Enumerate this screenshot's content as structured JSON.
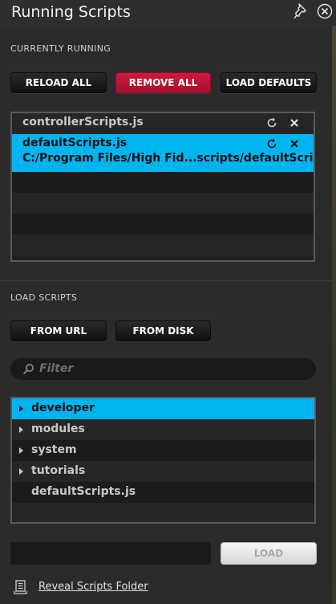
{
  "window": {
    "title": "Running Scripts",
    "pin_icon": "pin-icon",
    "close_icon": "close-icon"
  },
  "running": {
    "section_title": "CURRENTLY RUNNING",
    "buttons": {
      "reload_all": "RELOAD ALL",
      "remove_all": "REMOVE ALL",
      "load_defaults": "LOAD DEFAULTS"
    },
    "scripts": [
      {
        "name": "controllerScripts.js",
        "path": ""
      },
      {
        "name": "defaultScripts.js",
        "path": "C:/Program Files/High Fid...scripts/defaultScripts.js",
        "selected": true
      }
    ]
  },
  "load": {
    "section_title": "LOAD SCRIPTS",
    "buttons": {
      "from_url": "FROM URL",
      "from_disk": "FROM DISK",
      "load": "LOAD"
    },
    "filter_placeholder": "Filter",
    "tree": [
      {
        "label": "developer",
        "folder": true,
        "selected": true
      },
      {
        "label": "modules",
        "folder": true
      },
      {
        "label": "system",
        "folder": true
      },
      {
        "label": "tutorials",
        "folder": true
      },
      {
        "label": "defaultScripts.js",
        "folder": false
      }
    ],
    "url_value": "",
    "reveal_label": "Reveal Scripts Folder"
  },
  "colors": {
    "accent": "#00b4ef",
    "danger": "#c41436",
    "panel": "#2b2b2b"
  }
}
